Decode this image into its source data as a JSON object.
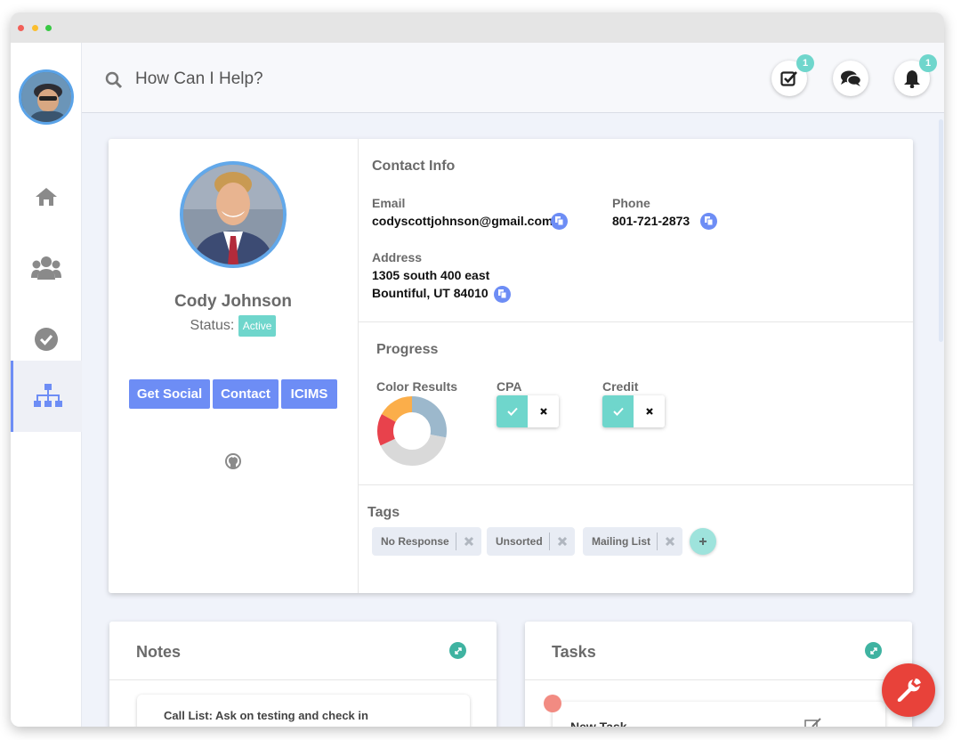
{
  "window": {
    "dot_colors": [
      "#f25f58",
      "#fbbe2e",
      "#38c944"
    ]
  },
  "sidebar": {
    "items": [
      {
        "icon": "home-icon",
        "active": false
      },
      {
        "icon": "users-icon",
        "active": false
      },
      {
        "icon": "check-circle-icon",
        "active": false
      },
      {
        "icon": "sitemap-icon",
        "active": true
      }
    ]
  },
  "topbar": {
    "search_placeholder": "How Can I Help?",
    "tasks_badge": "1",
    "notifications_badge": "1"
  },
  "profile": {
    "name": "Cody Johnson",
    "status_label": "Status:",
    "status_value": "Active",
    "buttons": [
      "Get Social",
      "Contact",
      "ICIMS"
    ]
  },
  "contact_info": {
    "title": "Contact Info",
    "email_label": "Email",
    "email": "codyscottjohnson@gmail.com",
    "phone_label": "Phone",
    "phone": "801-721-2873",
    "address_label": "Address",
    "address_line1": "1305 south 400 east",
    "address_line2": "Bountiful, UT 84010"
  },
  "progress": {
    "title": "Progress",
    "color_results_label": "Color Results",
    "color_results": [
      {
        "color": "blue",
        "value": 0.28,
        "hex": "#9cb8cc"
      },
      {
        "color": "gray",
        "value": 0.4,
        "hex": "#d9d9d9"
      },
      {
        "color": "red",
        "value": 0.15,
        "hex": "#e8424c"
      },
      {
        "color": "orange",
        "value": 0.17,
        "hex": "#fbae4a"
      }
    ],
    "cpa_label": "CPA",
    "credit_label": "Credit"
  },
  "tags": {
    "title": "Tags",
    "items": [
      "No Response",
      "Unsorted",
      "Mailing List"
    ]
  },
  "notes": {
    "title": "Notes",
    "first_note": "Call List: Ask on testing and check in"
  },
  "tasks": {
    "title": "Tasks",
    "first_task": "New Task"
  },
  "colors": {
    "accent": "#6d8df5",
    "teal": "#6fd6cc",
    "fab": "#e8423a"
  }
}
